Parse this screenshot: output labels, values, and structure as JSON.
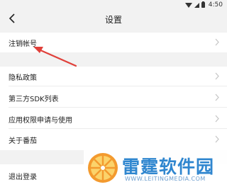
{
  "status_bar": {
    "time": "4:50"
  },
  "header": {
    "title": "设置"
  },
  "settings": {
    "cancel_account": "注销帐号",
    "privacy_policy": "隐私政策",
    "third_party_sdk": "第三方SDK列表",
    "permission_usage": "应用权限申请与使用",
    "about": "关于番茄",
    "logout": "退出登录"
  },
  "watermark": {
    "name": "雷霆软件园",
    "url": "WWW.LEITINGMEDIA.COM"
  },
  "colors": {
    "annotation_arrow": "#e0403a",
    "watermark_text": "#2f86cf",
    "watermark_logo": "#f39a2e"
  },
  "icons": [
    "wifi-icon",
    "signal-icon",
    "battery-icon",
    "back-arrow-icon",
    "chevron-right-icon"
  ]
}
